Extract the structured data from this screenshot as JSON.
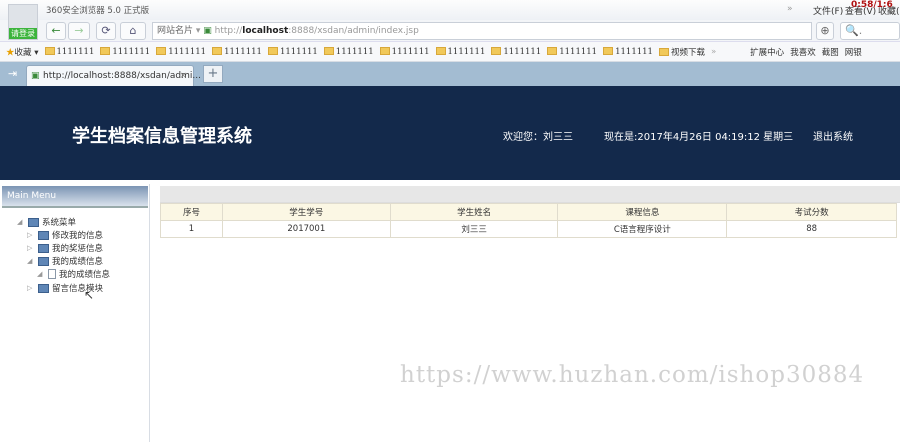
{
  "browser": {
    "title": "360安全浏览器 5.0 正式版",
    "login": "请登录",
    "site_name_btn": "网站名片",
    "url_prefix": "http://",
    "url_host": "localhost",
    "url_rest": ":8888/xsdan/admin/index.jsp",
    "menu": [
      "文件(F)",
      "查看(V)",
      "收藏("
    ],
    "timer": "0:58/1:6",
    "search_placeholder": "🔍.",
    "bookmarks_label": "收藏",
    "bookmarks": [
      "1111111",
      "1111111",
      "1111111",
      "1111111",
      "1111111",
      "1111111",
      "1111111",
      "1111111",
      "1111111",
      "1111111",
      "1111111",
      "视频下载"
    ],
    "right_tools": [
      "扩展中心",
      "我喜欢",
      "截图",
      "网银"
    ],
    "tab_title": "http://localhost:8888/xsdan/admi..."
  },
  "header": {
    "title": "学生档案信息管理系统",
    "welcome": "欢迎您：刘三三",
    "now": "现在是:2017年4月26日 04:19:12 星期三",
    "logout": "退出系统"
  },
  "sidebar": {
    "title": "Main Menu",
    "root": "系统菜单",
    "items": [
      "修改我的信息",
      "我的奖惩信息",
      "我的成绩信息",
      "我的成绩信息",
      "留言信息模块"
    ]
  },
  "table": {
    "headers": [
      "序号",
      "学生学号",
      "学生姓名",
      "课程信息",
      "考试分数"
    ],
    "rows": [
      [
        "1",
        "2017001",
        "刘三三",
        "C语言程序设计",
        "88"
      ]
    ]
  },
  "watermark": "https://www.huzhan.com/ishop30884"
}
